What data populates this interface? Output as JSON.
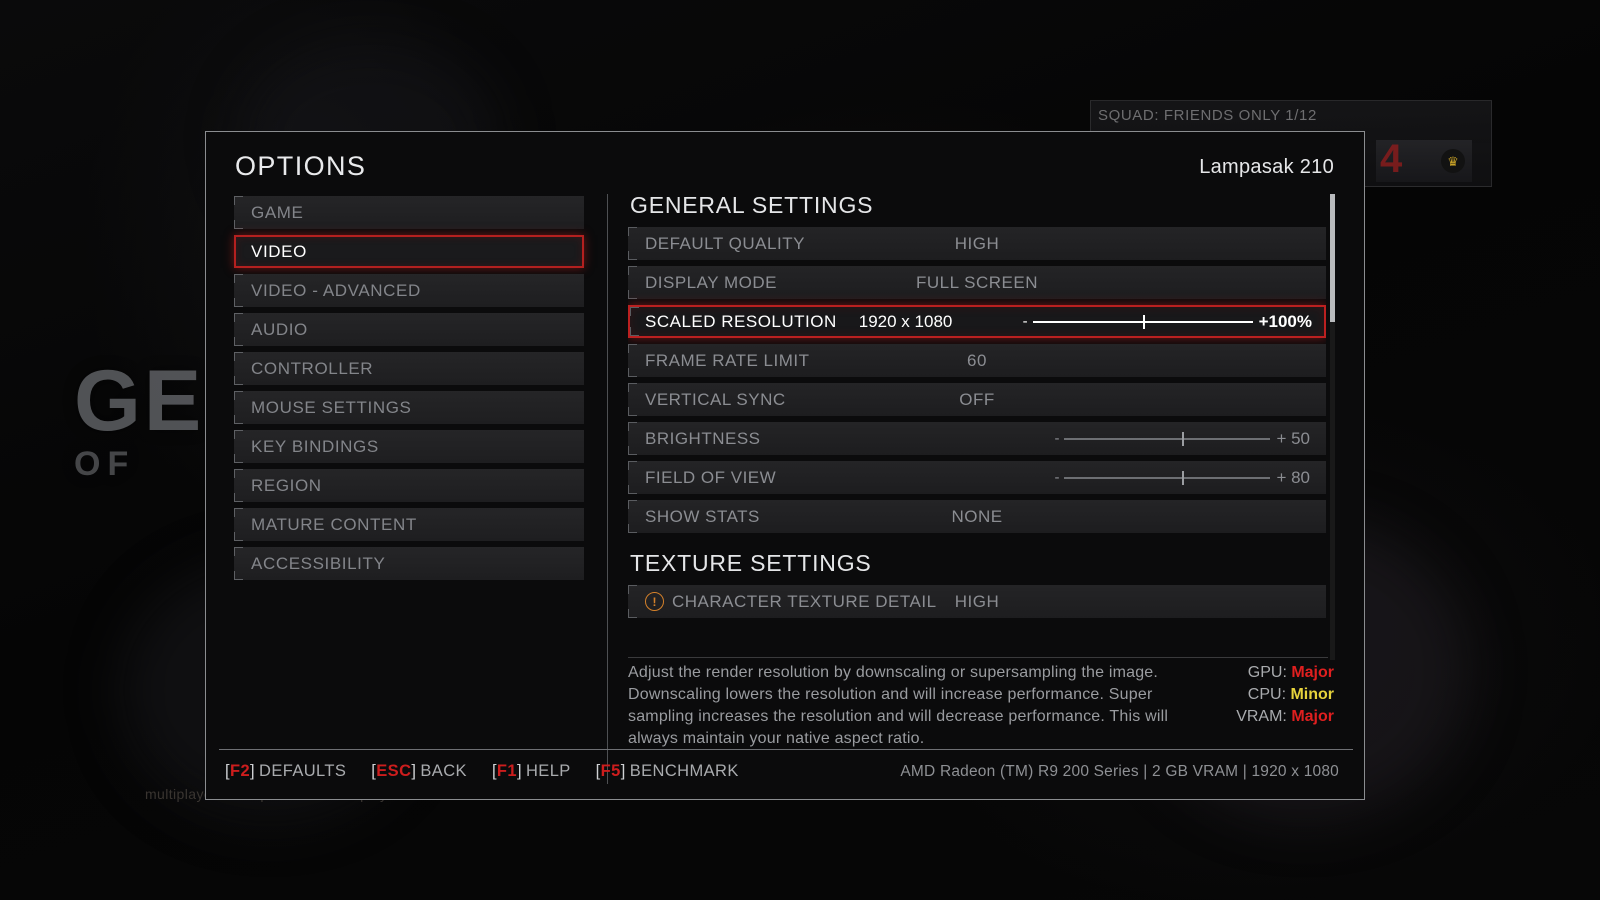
{
  "background": {
    "logo_main": "GE",
    "logo_sub": "OF",
    "tagline": "multiplayer with up to nine other players",
    "squad_status": "SQUAD: FRIENDS ONLY 1/12",
    "squad_emblem": "4",
    "crown_icon": "crown-icon"
  },
  "dialog": {
    "title": "OPTIONS",
    "player_name": "Lampasak 210"
  },
  "sidebar": {
    "items": [
      {
        "label": "GAME",
        "selected": false
      },
      {
        "label": "VIDEO",
        "selected": true
      },
      {
        "label": "VIDEO - ADVANCED",
        "selected": false
      },
      {
        "label": "AUDIO",
        "selected": false
      },
      {
        "label": "CONTROLLER",
        "selected": false
      },
      {
        "label": "MOUSE SETTINGS",
        "selected": false
      },
      {
        "label": "KEY BINDINGS",
        "selected": false
      },
      {
        "label": "REGION",
        "selected": false
      },
      {
        "label": "MATURE CONTENT",
        "selected": false
      },
      {
        "label": "ACCESSIBILITY",
        "selected": false
      }
    ]
  },
  "settings": {
    "general_header": "GENERAL SETTINGS",
    "texture_header": "TEXTURE SETTINGS",
    "general_rows": [
      {
        "name": "DEFAULT QUALITY",
        "value": "HIGH"
      },
      {
        "name": "DISPLAY MODE",
        "value": "FULL SCREEN"
      },
      {
        "name": "SCALED RESOLUTION",
        "inline_value": "1920 x 1080",
        "slider_minus": "-",
        "slider_amount": "+100%",
        "slider_pct": 50,
        "selected": true
      },
      {
        "name": "FRAME RATE LIMIT",
        "value": "60"
      },
      {
        "name": "VERTICAL SYNC",
        "value": "OFF"
      },
      {
        "name": "BRIGHTNESS",
        "slider_minus": "-",
        "slider_amount": "+ 50",
        "slider_pct": 57
      },
      {
        "name": "FIELD OF VIEW",
        "slider_minus": "-",
        "slider_amount": "+ 80",
        "slider_pct": 57
      },
      {
        "name": "SHOW STATS",
        "value": "NONE"
      }
    ],
    "texture_rows": [
      {
        "name": "CHARACTER TEXTURE DETAIL",
        "value": "HIGH",
        "warning": true,
        "warning_icon": "warning-icon"
      }
    ]
  },
  "description": {
    "text": "Adjust the render resolution by downscaling or supersampling the image. Downscaling lowers the resolution and will increase performance. Super sampling increases the resolution and will decrease performance. This will always maintain your native aspect ratio."
  },
  "impact": {
    "rows": [
      {
        "label": "GPU:",
        "value": "Major",
        "color": "#e01f1f"
      },
      {
        "label": "CPU:",
        "value": "Minor",
        "color": "#e6d33c"
      },
      {
        "label": "VRAM:",
        "value": "Major",
        "color": "#e01f1f"
      }
    ]
  },
  "footer": {
    "hotkeys": [
      {
        "key": "F2",
        "action": "DEFAULTS"
      },
      {
        "key": "ESC",
        "action": "BACK"
      },
      {
        "key": "F1",
        "action": "HELP"
      },
      {
        "key": "F5",
        "action": "BENCHMARK"
      }
    ],
    "system_info": "AMD Radeon (TM) R9 200 Series | 2 GB VRAM | 1920 x 1080"
  }
}
